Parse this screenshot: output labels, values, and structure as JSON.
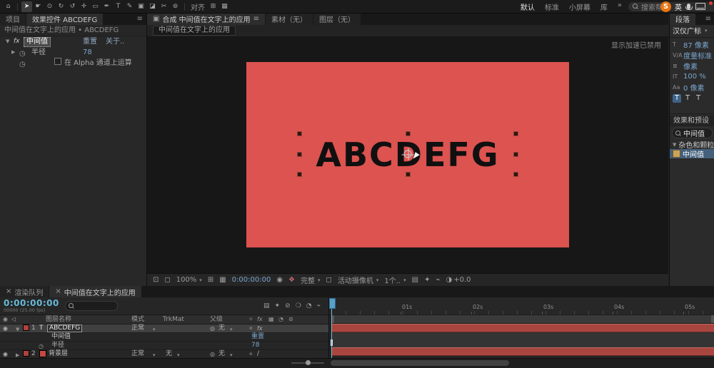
{
  "colors": {
    "canvas_red": "#dc5350",
    "layer_bar_red": "#a8453f"
  },
  "icons": {
    "panel_menu": "≡",
    "caret_down": "▾",
    "twirl_open": "▼",
    "twirl_closed": "▶",
    "eye": "◉",
    "speaker": "◁",
    "stopwatch": "◷",
    "pickwhip": "◎",
    "close": "×",
    "comp_badge": "▣",
    "window": "⊡",
    "grid": "⊞",
    "guides": "▦",
    "snapshot": "◉",
    "channels": "❖",
    "region": "◻",
    "fast_preview": "✦",
    "exposure": "◑",
    "motion_blur": "◔",
    "frame_blend": "❍",
    "graph_editor": "⌁",
    "flowchart": "▤",
    "shy": "⊘",
    "switches": "✧",
    "fx": "fx",
    "slash": "/",
    "align_a": "⊞",
    "align_b": "▦"
  },
  "topbar": {
    "tools": [
      {
        "name": "home-tool",
        "glyph": "⌂"
      },
      {
        "name": "selection-tool",
        "glyph": "➤"
      },
      {
        "name": "hand-tool",
        "glyph": "☛"
      },
      {
        "name": "zoom-tool",
        "glyph": "⊙"
      },
      {
        "name": "rotation-tool",
        "glyph": "↻"
      },
      {
        "name": "camera-tool",
        "glyph": "↺"
      },
      {
        "name": "pan-behind-tool",
        "glyph": "✛"
      },
      {
        "name": "shape-tool",
        "glyph": "▭"
      },
      {
        "name": "pen-tool",
        "glyph": "✒"
      },
      {
        "name": "type-tool",
        "glyph": "T"
      },
      {
        "name": "brush-tool",
        "glyph": "✎"
      },
      {
        "name": "clone-stamp-tool",
        "glyph": "▣"
      },
      {
        "name": "eraser-tool",
        "glyph": "◪"
      },
      {
        "name": "roto-brush-tool",
        "glyph": "✂"
      },
      {
        "name": "puppet-pin-tool",
        "glyph": "⊚"
      }
    ],
    "align_label": "对齐",
    "workspaces": [
      "默认",
      "标准",
      "小屏幕",
      "库"
    ],
    "workspace_overflow": "»",
    "search_placeholder": "搜索帮助",
    "logo_letter": "S",
    "ime_lang": "英"
  },
  "effect_controls": {
    "tab_project": "项目",
    "tab_effect_controls": "效果控件 ABCDEFG",
    "breadcrumb": "中间值在文字上的应用 • ABCDEFG",
    "effect_name": "中间值",
    "reset_label": "重置",
    "about_label": "关于..",
    "radius_label": "半径",
    "radius_value": "78",
    "alpha_label": "在 Alpha 通道上运算"
  },
  "composition": {
    "tab_comp": "合成 中间值在文字上的应用",
    "tab_footage": "素材（无）",
    "tab_layer": "图层（无）",
    "nav_chip": "中间值在文字上的应用",
    "acceleration_notice": "显示加速已禁用",
    "canvas_text": "ABCDEFG",
    "zoom_value": "100%",
    "timecode": "0:00:00:00",
    "resolution_value": "完整",
    "camera_value": "活动摄像机",
    "view_layout_value": "1个..",
    "exposure_value": "+0.0"
  },
  "right_panel": {
    "tab_paragraph": "段落",
    "font_family": "汉仪广标",
    "char_rows": [
      {
        "glyph": "T",
        "value": "87 像素"
      },
      {
        "glyph": "V∕A",
        "value": "度量标准"
      },
      {
        "glyph": "≣",
        "value": "像素"
      },
      {
        "glyph": "IT",
        "value": "100 %"
      },
      {
        "glyph": "Aa",
        "value": "0 像素"
      }
    ],
    "style_buttons": [
      "T",
      "T",
      "T"
    ],
    "effects_presets_title": "效果和预设",
    "search_value": "中间值",
    "group_label": "杂色和颗粒",
    "item_label": "中间值"
  },
  "timeline": {
    "tab_render_queue": "渲染队列",
    "tab_comp": "中间值在文字上的应用",
    "timecode": "0:00:00:00",
    "frame_info": "00000 (25.00 fps)",
    "col_layer_name": "图层名称",
    "col_mode": "模式",
    "col_trkmat": "TrkMat",
    "col_parent": "父级",
    "layer1": {
      "index": "1",
      "type": "T",
      "name": "ABCDEFG",
      "mode": "正常",
      "parent_label": "无"
    },
    "effect_row": {
      "name": "中间值",
      "reset": "重置"
    },
    "param_row": {
      "name": "半径",
      "value": "78"
    },
    "layer2": {
      "index": "2",
      "name": "背景层",
      "mode": "正常",
      "trkmat": "无",
      "parent_label": "无"
    },
    "ruler_labels": [
      "01s",
      "02s",
      "03s",
      "04s",
      "05s"
    ]
  }
}
